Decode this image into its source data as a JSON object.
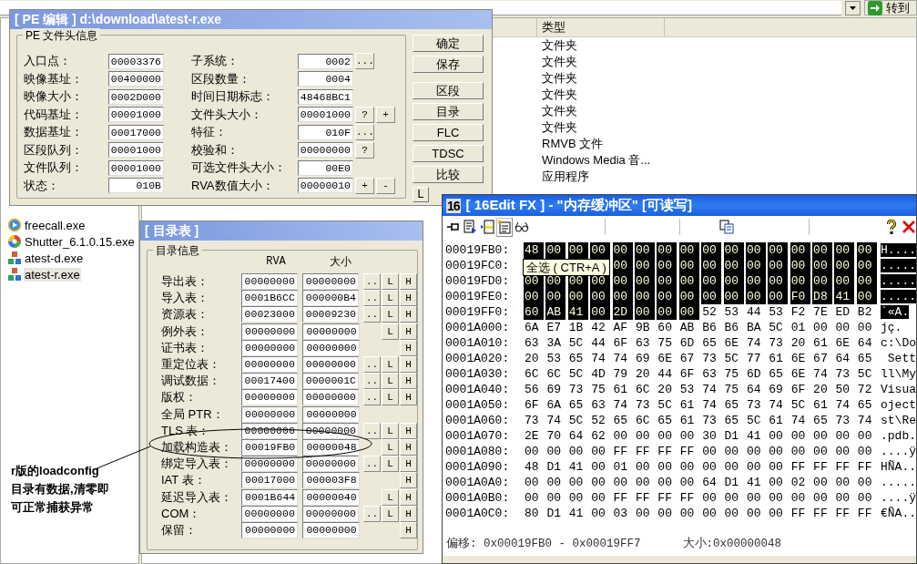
{
  "explorer": {
    "go_button": "转到",
    "files": [
      {
        "name": "freecall.exe",
        "kind": "globe",
        "selected": false
      },
      {
        "name": "Shutter_6.1.0.15.exe",
        "kind": "ball",
        "selected": false
      },
      {
        "name": "atest-d.exe",
        "kind": "blocks",
        "selected": false
      },
      {
        "name": "atest-r.exe",
        "kind": "blocks",
        "selected": true
      }
    ],
    "columns": [
      {
        "label": "类型"
      }
    ],
    "rows": [
      {
        "type": "文件夹"
      },
      {
        "type": "文件夹"
      },
      {
        "type": "文件夹"
      },
      {
        "type": "文件夹"
      },
      {
        "type": "文件夹"
      },
      {
        "type": "文件夹"
      },
      {
        "type": "RMVB 文件"
      },
      {
        "type": "Windows Media 音..."
      },
      {
        "type": "应用程序"
      }
    ]
  },
  "pe_editor": {
    "title": "[ PE 编辑 ] d:\\download\\atest-r.exe",
    "group": "PE 文件头信息",
    "left_fields": [
      {
        "label": "入口点：",
        "value": "00003376"
      },
      {
        "label": "映像基址：",
        "value": "00400000"
      },
      {
        "label": "映像大小：",
        "value": "0002D000"
      },
      {
        "label": "代码基址：",
        "value": "00001000"
      },
      {
        "label": "数据基址：",
        "value": "00017000"
      },
      {
        "label": "区段队列：",
        "value": "00001000"
      },
      {
        "label": "文件队列：",
        "value": "00001000"
      },
      {
        "label": "状态：",
        "value": "010B"
      }
    ],
    "right_fields": [
      {
        "label": "子系统：",
        "value": "0002",
        "buttons": [
          "..."
        ]
      },
      {
        "label": "区段数量：",
        "value": "0004"
      },
      {
        "label": "时间日期标志：",
        "value": "48468BC1"
      },
      {
        "label": "文件头大小：",
        "value": "00001000",
        "buttons": [
          "?",
          "+"
        ]
      },
      {
        "label": "特征：",
        "value": "010F",
        "buttons": [
          "..."
        ]
      },
      {
        "label": "校验和：",
        "value": "00000000",
        "buttons": [
          "?"
        ]
      },
      {
        "label": "可选文件头大小：",
        "value": "00E0"
      },
      {
        "label": "RVA数值大小：",
        "value": "00000010",
        "buttons": [
          "+",
          "-"
        ]
      }
    ],
    "buttons": [
      "确定",
      "保存",
      "区段",
      "目录",
      "FLC",
      "TDSC",
      "比较",
      "L"
    ]
  },
  "dir_table": {
    "title": "[ 目录表 ]",
    "group": "目录信息",
    "columns": [
      "RVA",
      "大小"
    ],
    "rows": [
      {
        "label": "导出表：",
        "rva": "00000000",
        "size": "00000000",
        "buttons": [
          "..",
          "L",
          "H"
        ]
      },
      {
        "label": "导入表：",
        "rva": "0001B6CC",
        "size": "000000B4",
        "buttons": [
          "..",
          "L",
          "H"
        ]
      },
      {
        "label": "资源表：",
        "rva": "00023000",
        "size": "00009230",
        "buttons": [
          "..",
          "L",
          "H"
        ]
      },
      {
        "label": "例外表：",
        "rva": "00000000",
        "size": "00000000",
        "buttons": [
          "L",
          "H"
        ]
      },
      {
        "label": "证书表：",
        "rva": "00000000",
        "size": "00000000",
        "buttons": [
          "H"
        ]
      },
      {
        "label": "重定位表：",
        "rva": "00000000",
        "size": "00000000",
        "buttons": [
          "..",
          "L",
          "H"
        ]
      },
      {
        "label": "调试数据：",
        "rva": "00017400",
        "size": "0000001C",
        "buttons": [
          "..",
          "L",
          "H"
        ]
      },
      {
        "label": "版权：",
        "rva": "00000000",
        "size": "00000000",
        "buttons": [
          "..",
          "L",
          "H"
        ]
      },
      {
        "label": "全局 PTR：",
        "rva": "00000000",
        "size": "00000000"
      },
      {
        "label": "TLS 表：",
        "rva": "00000000",
        "size": "00000000",
        "buttons": [
          "..",
          "L",
          "H"
        ]
      },
      {
        "label": "加载构造表：",
        "rva": "00019FB0",
        "size": "00000048",
        "buttons": [
          "L",
          "H"
        ]
      },
      {
        "label": "绑定导入表：",
        "rva": "00000000",
        "size": "00000000",
        "buttons": [
          "..",
          "L",
          "H"
        ]
      },
      {
        "label": "IAT 表：",
        "rva": "00017000",
        "size": "000003F8",
        "buttons": [
          "H"
        ]
      },
      {
        "label": "延迟导入表：",
        "rva": "0001B644",
        "size": "00000040",
        "buttons": [
          "L",
          "H"
        ]
      },
      {
        "label": "COM：",
        "rva": "00000000",
        "size": "00000000",
        "buttons": [
          "..",
          "L",
          "H"
        ]
      },
      {
        "label": "保留：",
        "rva": "00000000",
        "size": "00000000",
        "buttons": [
          "H"
        ]
      }
    ]
  },
  "hex_editor": {
    "app_badge": "16",
    "title": "[ 16Edit FX ] - \"内存缓冲区\" [可读写]",
    "tooltip": "全选 ( CTR+A )",
    "rows": [
      {
        "address": "00019FB0:",
        "selected_bytes": "48 00 00 00 00 00 00 00 00 00 00 00 00 00 00 00",
        "selected_ascii": "H...."
      },
      {
        "address": "00019FC0:",
        "selected_bytes": "00 00 00 00 00 00 00 00 00 00 00 00",
        "selected_ascii": "....."
      },
      {
        "address": "00019FD0:",
        "selected_bytes": "00 00 00 00 00 00 00 00 00 00 00 00 00 00 00 00",
        "selected_ascii": "....."
      },
      {
        "address": "00019FE0:",
        "selected_bytes": "00 00 00 00 00 00 00 00 00 00 00 00 F0 D8 41 00",
        "selected_ascii": "....."
      },
      {
        "address": "00019FF0:",
        "selected_bytes": "60 AB 41 00 2D 00 00 00",
        "bytes": "52 53 44 53 F2 7E ED B2",
        "selected_ascii": "`«A."
      },
      {
        "address": "0001A000:",
        "bytes": "6A E7 1B 42 AF 9B 60 AB B6 B6 BA 5C 01 00 00 00",
        "ascii": "jç."
      },
      {
        "address": "0001A010:",
        "bytes": "63 3A 5C 44 6F 63 75 6D 65 6E 74 73 20 61 6E 64",
        "ascii": "c:\\Do"
      },
      {
        "address": "0001A020:",
        "bytes": "20 53 65 74 74 69 6E 67 73 5C 77 61 6E 67 64 65",
        "ascii": " Sett"
      },
      {
        "address": "0001A030:",
        "bytes": "6C 6C 5C 4D 79 20 44 6F 63 75 6D 65 6E 74 73 5C",
        "ascii": "ll\\My"
      },
      {
        "address": "0001A040:",
        "bytes": "56 69 73 75 61 6C 20 53 74 75 64 69 6F 20 50 72",
        "ascii": "Visua"
      },
      {
        "address": "0001A050:",
        "bytes": "6F 6A 65 63 74 73 5C 61 74 65 73 74 5C 61 74 65",
        "ascii": "oject"
      },
      {
        "address": "0001A060:",
        "bytes": "73 74 5C 52 65 6C 65 61 73 65 5C 61 74 65 73 74",
        "ascii": "st\\Re"
      },
      {
        "address": "0001A070:",
        "bytes": "2E 70 64 62 00 00 00 00 30 D1 41 00 00 00 00 00",
        "ascii": ".pdb."
      },
      {
        "address": "0001A080:",
        "bytes": "00 00 00 00 FF FF FF FF 00 00 00 00 00 00 00 00",
        "ascii": "....ÿ"
      },
      {
        "address": "0001A090:",
        "bytes": "48 D1 41 00 01 00 00 00 00 00 00 00 FF FF FF FF",
        "ascii": "HÑA.."
      },
      {
        "address": "0001A0A0:",
        "bytes": "00 00 00 00 00 00 00 00 64 D1 41 00 02 00 00 00",
        "ascii": "....."
      },
      {
        "address": "0001A0B0:",
        "bytes": "00 00 00 00 FF FF FF FF 00 00 00 00 00 00 00 00",
        "ascii": "....ÿ"
      },
      {
        "address": "0001A0C0:",
        "bytes": "80 D1 41 00 03 00 00 00 00 00 00 00 FF FF FF FF",
        "ascii": "€ÑA.."
      }
    ],
    "status": {
      "offset": "偏移: 0x00019FB0 - 0x00019FF7",
      "size": "大小:0x00000048"
    }
  },
  "annotation": {
    "lines": [
      "r版的loadconfig",
      "目录有数据,清零即",
      "可正常捕获异常"
    ]
  }
}
